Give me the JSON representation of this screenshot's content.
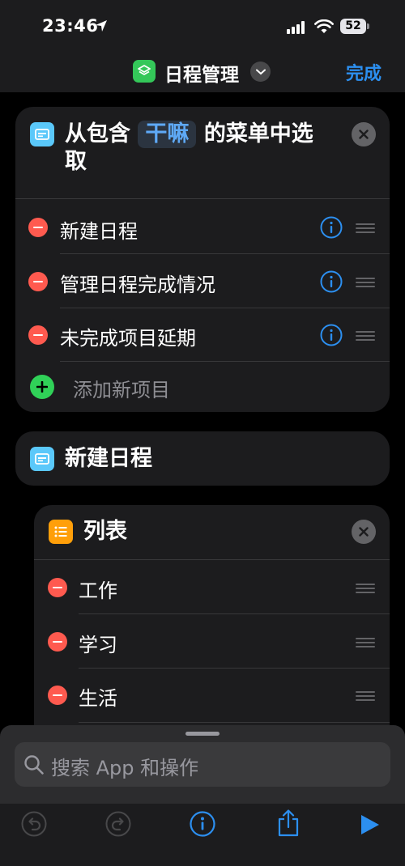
{
  "status": {
    "time": "23:46",
    "battery": "52"
  },
  "nav": {
    "title": "日程管理",
    "done_label": "完成"
  },
  "menu_action": {
    "title_prefix": "从包含",
    "variable": "干嘛",
    "title_suffix_line1": "的菜单中选",
    "title_line2": "取",
    "items": [
      {
        "label": "新建日程"
      },
      {
        "label": "管理日程完成情况"
      },
      {
        "label": "未完成项目延期"
      }
    ],
    "add_label": "添加新项目"
  },
  "case_header": {
    "label": "新建日程"
  },
  "list_action": {
    "title": "列表",
    "items": [
      {
        "label": "工作"
      },
      {
        "label": "学习"
      },
      {
        "label": "生活"
      }
    ]
  },
  "search": {
    "placeholder": "搜索 App 和操作"
  },
  "toolbar": {
    "icons": [
      "undo-icon",
      "redo-icon",
      "info-icon",
      "share-icon",
      "play-icon"
    ]
  },
  "colors": {
    "accent": "#2c8ff0",
    "card": "#1c1c1e",
    "delete": "#ff5a4f",
    "add": "#30d158",
    "menu_badge": "#5ac8fa",
    "list_badge": "#ff9f0a"
  }
}
